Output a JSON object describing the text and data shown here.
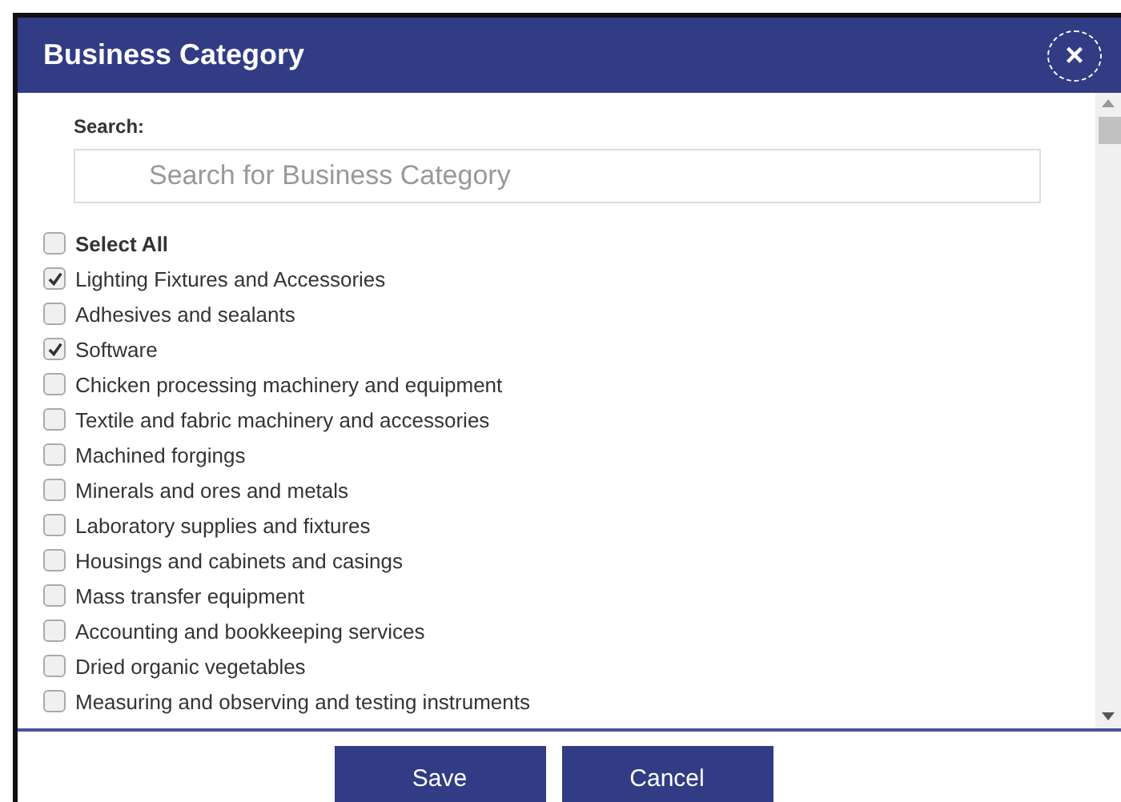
{
  "dialog": {
    "title": "Business Category",
    "close_label": "×"
  },
  "search": {
    "label": "Search:",
    "placeholder": "Search for Business Category"
  },
  "select_all": {
    "label": "Select All",
    "checked": false
  },
  "items": [
    {
      "label": "Lighting Fixtures and Accessories",
      "checked": true
    },
    {
      "label": "Adhesives and sealants",
      "checked": false
    },
    {
      "label": "Software",
      "checked": true
    },
    {
      "label": "Chicken processing machinery and equipment",
      "checked": false
    },
    {
      "label": "Textile and fabric machinery and accessories",
      "checked": false
    },
    {
      "label": "Machined forgings",
      "checked": false
    },
    {
      "label": "Minerals and ores and metals",
      "checked": false
    },
    {
      "label": "Laboratory supplies and fixtures",
      "checked": false
    },
    {
      "label": "Housings and cabinets and casings",
      "checked": false
    },
    {
      "label": "Mass transfer equipment",
      "checked": false
    },
    {
      "label": "Accounting and bookkeeping services",
      "checked": false
    },
    {
      "label": "Dried organic vegetables",
      "checked": false
    },
    {
      "label": "Measuring and observing and testing instruments",
      "checked": false
    }
  ],
  "buttons": [
    "Save",
    "Cancel"
  ]
}
